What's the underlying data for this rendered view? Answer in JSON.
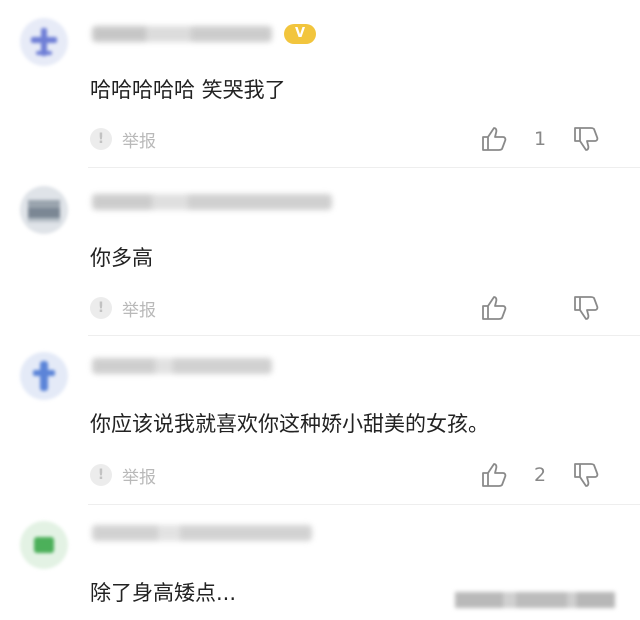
{
  "comments": [
    {
      "avatar_icon": "airplane-avatar-icon",
      "avatar_color": "#6f7fd6",
      "has_vip_badge": true,
      "vip_badge_text": "V",
      "text": "哈哈哈哈哈 笑哭我了",
      "report_label": "举报",
      "like_count": "1"
    },
    {
      "avatar_icon": "pixelated-avatar-icon",
      "avatar_color": "#8f9aa6",
      "has_vip_badge": false,
      "text": "你多高",
      "report_label": "举报",
      "like_count": ""
    },
    {
      "avatar_icon": "figure-avatar-icon",
      "avatar_color": "#5b84d8",
      "has_vip_badge": false,
      "text": "你应该说我就喜欢你这种娇小甜美的女孩。",
      "report_label": "举报",
      "like_count": "2"
    },
    {
      "avatar_icon": "green-avatar-icon",
      "avatar_color": "#4cb05a",
      "has_vip_badge": false,
      "text": "除了身高矮点...",
      "report_label": "",
      "like_count": ""
    }
  ],
  "colors": {
    "text": "#222222",
    "muted": "#b9b9b9",
    "vip": "#f2c53d",
    "divider": "#eeeeee"
  }
}
